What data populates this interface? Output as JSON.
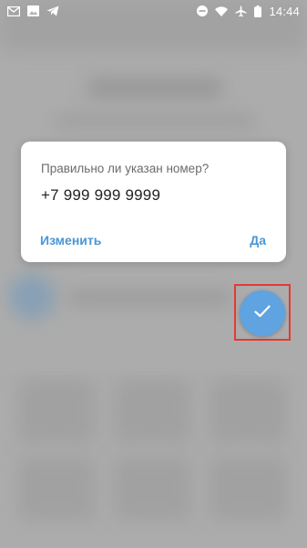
{
  "status_bar": {
    "time": "14:44",
    "left_icons": [
      "gmail-icon",
      "image-icon",
      "telegram-icon"
    ],
    "right_icons": [
      "do-not-disturb-icon",
      "wifi-icon",
      "airplane-mode-icon",
      "battery-icon"
    ]
  },
  "dialog": {
    "question": "Правильно ли указан номер?",
    "phone": "+7 999 999 9999",
    "edit_label": "Изменить",
    "confirm_label": "Да"
  },
  "fab": {
    "icon": "checkmark-icon",
    "color": "#5fa3e0",
    "highlight_color": "#e53935"
  },
  "colors": {
    "accent": "#4a96d6",
    "overlay": "#b3b3b3"
  }
}
